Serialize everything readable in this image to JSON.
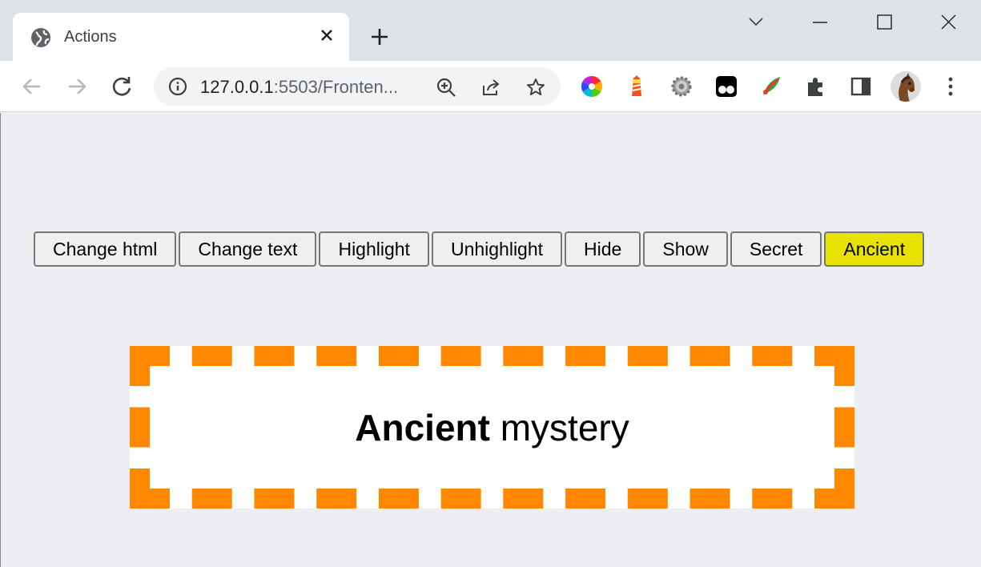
{
  "browser": {
    "tab": {
      "title": "Actions"
    },
    "address": {
      "host": "127.0.0.1",
      "path": ":5503/Fronten..."
    }
  },
  "page": {
    "buttons": [
      {
        "label": "Change html",
        "highlighted": false
      },
      {
        "label": "Change text",
        "highlighted": false
      },
      {
        "label": "Highlight",
        "highlighted": false
      },
      {
        "label": "Unhighlight",
        "highlighted": false
      },
      {
        "label": "Hide",
        "highlighted": false
      },
      {
        "label": "Show",
        "highlighted": false
      },
      {
        "label": "Secret",
        "highlighted": false
      },
      {
        "label": "Ancient",
        "highlighted": true
      }
    ],
    "mystery": {
      "bold": "Ancient",
      "rest": " mystery"
    }
  },
  "colors": {
    "highlight": "#e8e200",
    "border_dash": "#ff8800",
    "page_bg": "#eceef1"
  },
  "icons": [
    "globe-icon",
    "close-icon",
    "plus-icon",
    "chevron-down-icon",
    "minimize-icon",
    "maximize-icon",
    "window-close-icon",
    "back-arrow-icon",
    "forward-arrow-icon",
    "reload-icon",
    "info-icon",
    "zoom-icon",
    "share-icon",
    "star-icon",
    "color-wheel-extension-icon",
    "lighthouse-extension-icon",
    "gear-extension-icon",
    "tampermonkey-extension-icon",
    "feather-extension-icon",
    "puzzle-icon",
    "side-panel-icon",
    "kebab-menu-icon"
  ]
}
